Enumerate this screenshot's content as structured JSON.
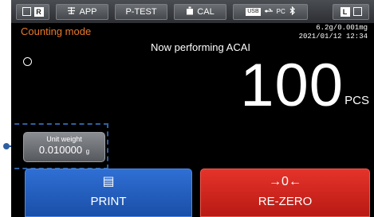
{
  "topbar": {
    "r_label": "R",
    "app_label": "APP",
    "ptest_label": "P-TEST",
    "cal_label": "CAL",
    "usb_label": "USB",
    "pc_label": "PC",
    "l_label": "L"
  },
  "header": {
    "mode": "Counting mode",
    "capacity": "6.2g/0.001mg",
    "datetime": "2021/01/12  12:34",
    "status": "Now performing ACAI"
  },
  "display": {
    "value": "100",
    "unit": "PCS"
  },
  "unit_weight": {
    "label": "Unit weight",
    "value": "0.010000",
    "unit": "g"
  },
  "buttons": {
    "print_icon": "▤",
    "print_label": "PRINT",
    "rezero_icon": "→0←",
    "rezero_label": "RE-ZERO"
  },
  "colors": {
    "mode_text": "#e8792b",
    "print": "#2f6fd4",
    "rezero": "#e5332a",
    "highlight": "#2f5fa0"
  },
  "icons": {
    "app": "adjust-icon",
    "cal": "calibration-weight-icon",
    "pc": "pc-connection-icon",
    "bluetooth": "bluetooth-icon"
  }
}
